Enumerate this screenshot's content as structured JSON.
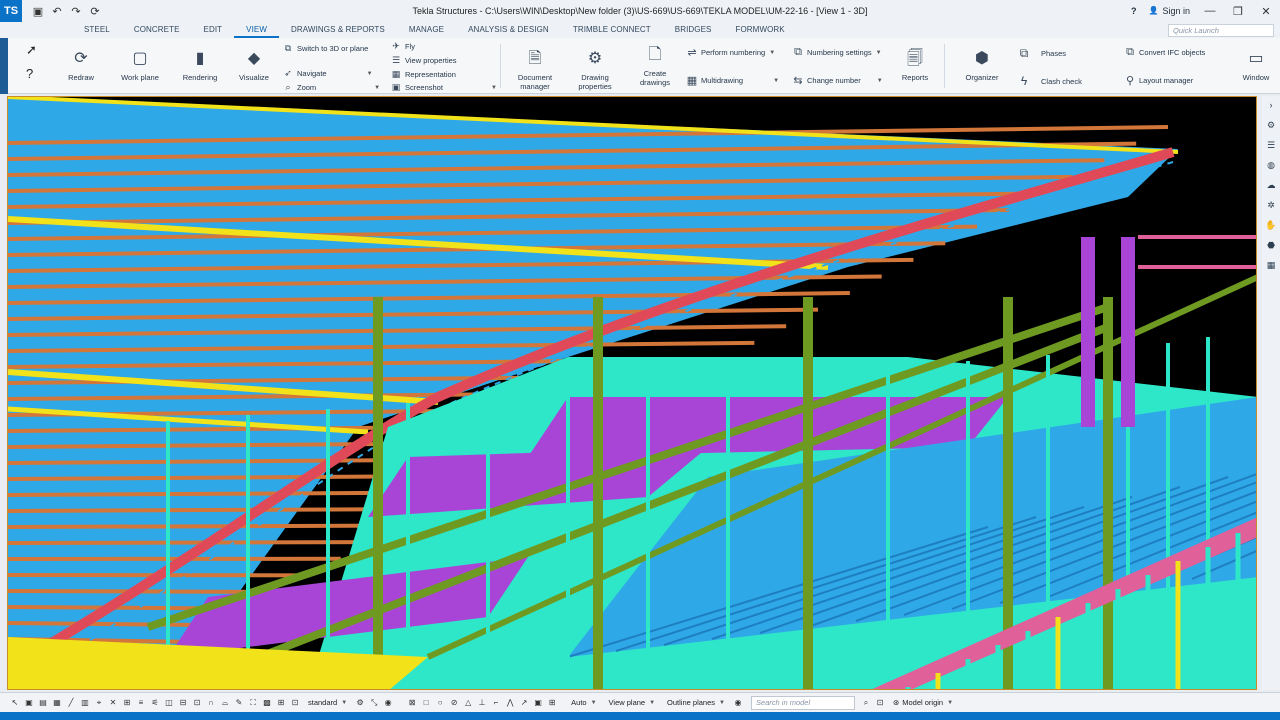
{
  "titlebar": {
    "app_logo": "TS",
    "title": "Tekla Structures - C:\\Users\\WIN\\Desktop\\New folder (3)\\US-669\\US-669\\TEKLA MODEL\\UM-22-16 - [View 1 - 3D]",
    "sign_in": "Sign in",
    "help_glyph": "?",
    "user_glyph": "👤",
    "undo_glyph": "↶",
    "redo_glyph": "↷",
    "save_glyph": "▣",
    "history_glyph": "⟳",
    "minimize_glyph": "—",
    "restore_glyph": "❐",
    "close_glyph": "✕"
  },
  "menu": {
    "tabs": [
      {
        "label": "STEEL"
      },
      {
        "label": "CONCRETE"
      },
      {
        "label": "EDIT"
      },
      {
        "label": "VIEW"
      },
      {
        "label": "DRAWINGS & REPORTS"
      },
      {
        "label": "MANAGE"
      },
      {
        "label": "ANALYSIS & DESIGN"
      },
      {
        "label": "TRIMBLE CONNECT"
      },
      {
        "label": "BRIDGES"
      },
      {
        "label": "FORMWORK"
      }
    ],
    "active_index": 3,
    "quick_launch_placeholder": "Quick Launch"
  },
  "ribbon": {
    "redraw": "Redraw",
    "work_plane": "Work plane",
    "rendering": "Rendering",
    "visualize": "Visualize",
    "switch_3d": "Switch to 3D or plane",
    "fly": "Fly",
    "view_properties": "View properties",
    "navigate": "Navigate",
    "representation": "Representation",
    "zoom": "Zoom",
    "screenshot": "Screenshot",
    "document_manager": "Document manager",
    "drawing_properties": "Drawing properties",
    "create_drawings": "Create drawings",
    "perform_numbering": "Perform numbering",
    "multidrawing": "Multidrawing",
    "numbering_settings": "Numbering settings",
    "change_number": "Change number",
    "reports": "Reports",
    "organizer": "Organizer",
    "phases": "Phases",
    "clash_check": "Clash check",
    "convert_ifc": "Convert IFC objects",
    "layout_manager": "Layout manager",
    "window": "Window"
  },
  "bottom": {
    "standard": "standard",
    "auto": "Auto",
    "view_plane": "View plane",
    "outline_planes": "Outline planes",
    "search_placeholder": "Search in model",
    "model_origin": "Model origin"
  },
  "colors": {
    "accent": "#0a72c7",
    "sky_blue": "#2fa8e8",
    "purlin_orange": "#d3763a",
    "rafter_red": "#e04a58",
    "yellow": "#f2e21a",
    "cyan": "#2ee6c8",
    "magenta": "#a845d6",
    "olive": "#6f9a22",
    "pink": "#e0609a"
  }
}
